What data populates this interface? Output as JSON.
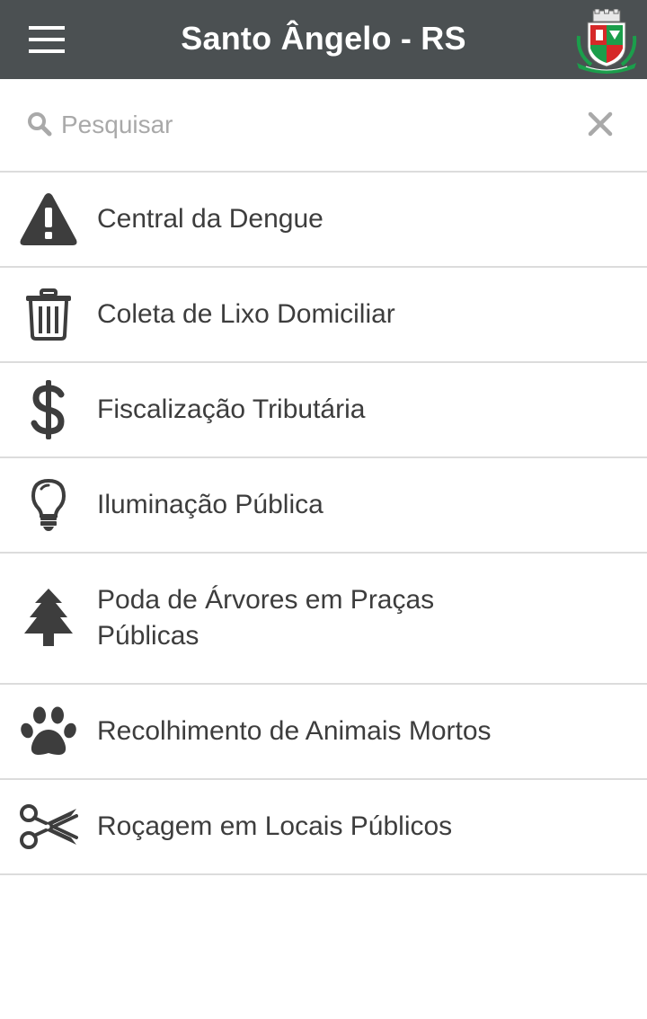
{
  "header": {
    "title": "Santo Ângelo - RS",
    "background_color": "#4b5052",
    "menu_icon": "hamburger-menu-icon",
    "crest_icon": "santo-angelo-coat-of-arms"
  },
  "search": {
    "placeholder": "Pesquisar",
    "value": "",
    "search_icon": "magnifier-icon",
    "clear_icon": "close-icon"
  },
  "services": [
    {
      "label": "Central da Dengue",
      "icon": "warning-triangle-icon"
    },
    {
      "label": "Coleta de Lixo Domiciliar",
      "icon": "trash-can-icon"
    },
    {
      "label": "Fiscalização Tributária",
      "icon": "dollar-sign-icon"
    },
    {
      "label": "Iluminação Pública",
      "icon": "lightbulb-icon"
    },
    {
      "label": "Poda de Árvores em Praças Públicas",
      "icon": "tree-icon"
    },
    {
      "label": "Recolhimento de Animais Mortos",
      "icon": "paw-icon"
    },
    {
      "label": "Roçagem em Locais Públicos",
      "icon": "scissors-icon"
    }
  ],
  "colors": {
    "icon": "#3d3d3d",
    "divider": "#dcdcdc",
    "placeholder": "#a9a9a9"
  }
}
